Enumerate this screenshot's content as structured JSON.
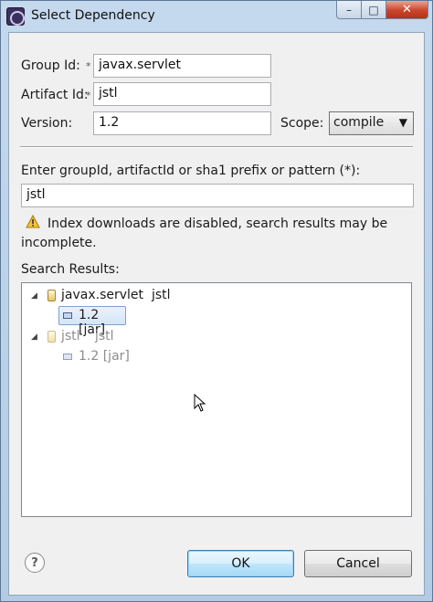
{
  "window": {
    "title": "Select Dependency",
    "controls": {
      "minimize": "–",
      "maximize": "□",
      "close": "✕"
    }
  },
  "form": {
    "group_id": {
      "label": "Group Id:",
      "value": "javax.servlet"
    },
    "artifact_id": {
      "label": "Artifact Id:",
      "value": "jstl"
    },
    "version": {
      "label": "Version:",
      "value": "1.2"
    },
    "scope": {
      "label": "Scope:",
      "value": "compile"
    },
    "required_marker": "*"
  },
  "search": {
    "label": "Enter groupId, artifactId or sha1 prefix or pattern (*):",
    "value": "jstl",
    "warning_line1": "Index downloads are disabled, search results may be",
    "warning_line2": "incomplete.",
    "results_label": "Search Results:",
    "results": [
      {
        "group": "javax.servlet",
        "artifact": "jstl",
        "expanded": true,
        "versions": [
          {
            "label": "1.2 [jar]",
            "selected": true
          }
        ]
      },
      {
        "group": "jstl",
        "artifact": "jstl",
        "expanded": true,
        "disabled": true,
        "versions": [
          {
            "label": "1.2 [jar]",
            "selected": false
          }
        ]
      }
    ]
  },
  "buttons": {
    "help": "?",
    "ok": "OK",
    "cancel": "Cancel"
  },
  "colors": {
    "titlebar": "#b9cfe6",
    "close_button": "#c9452b",
    "selection": "#d4e5f8",
    "dim_text": "#8c8c8c"
  },
  "icons": [
    "app-icon",
    "warning-icon",
    "jar-icon",
    "version-icon",
    "expand-triangle-icon",
    "help-icon",
    "mouse-cursor-icon"
  ]
}
